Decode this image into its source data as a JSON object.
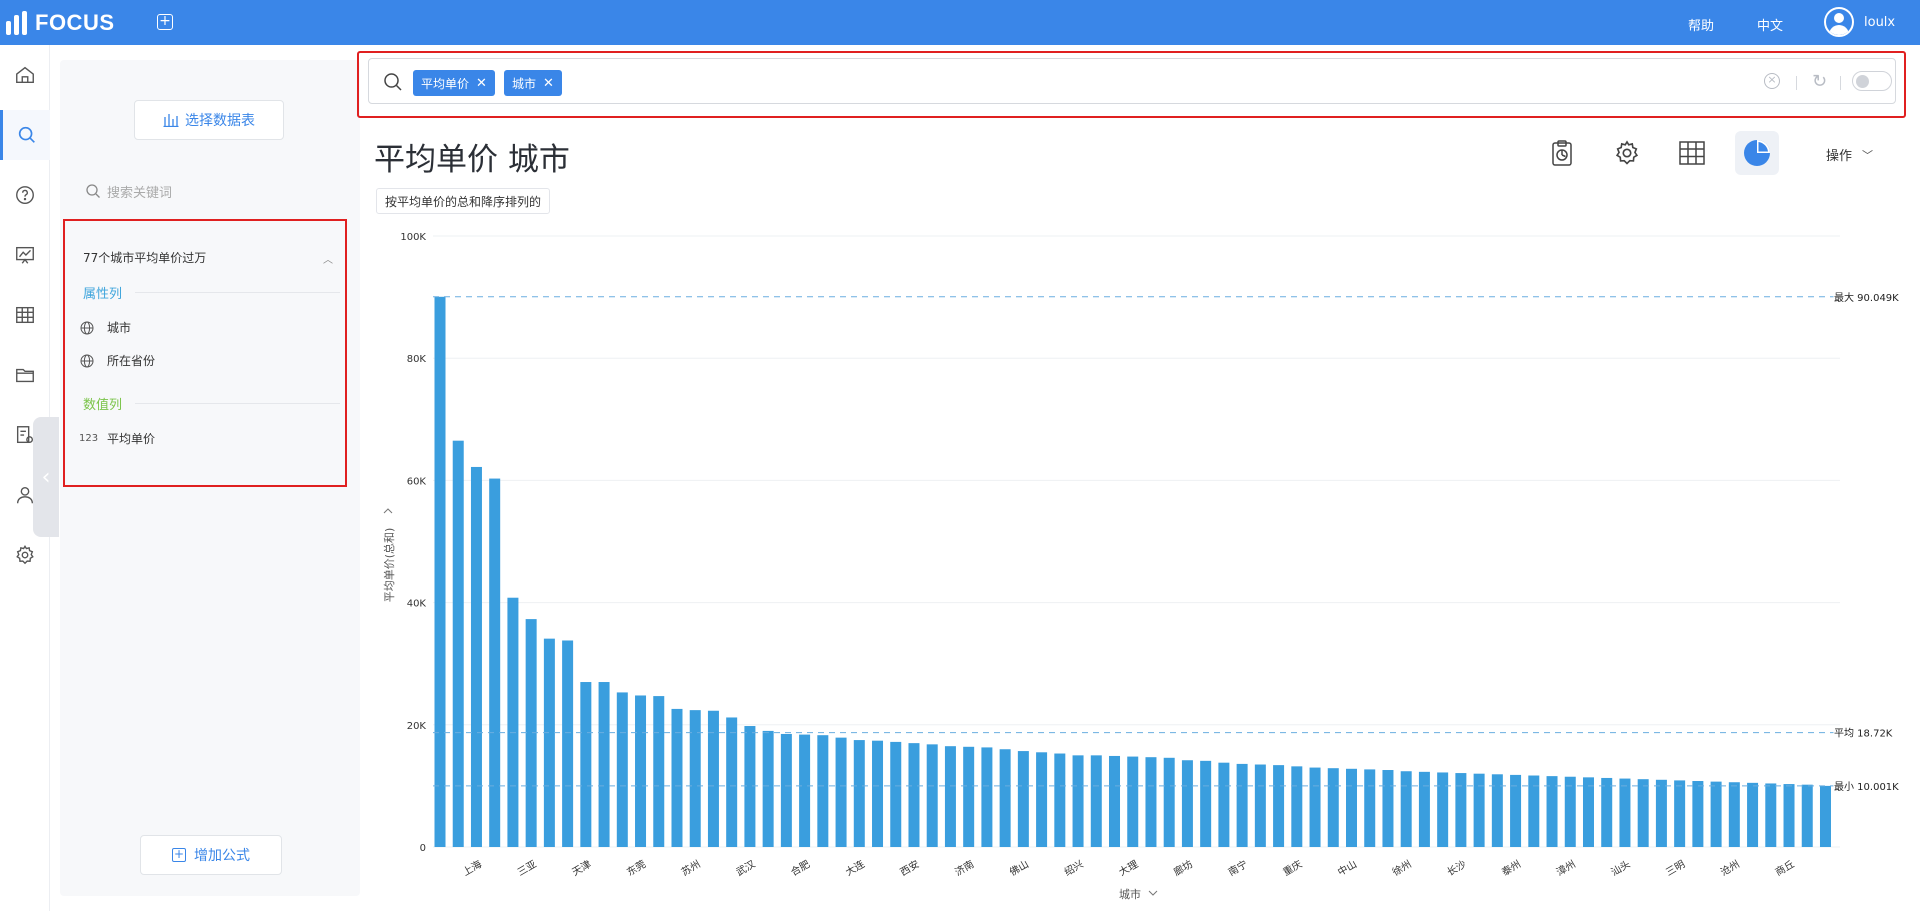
{
  "app": {
    "logo_text": "FOCUS",
    "help": "帮助",
    "language": "中文",
    "username": "loulx"
  },
  "nav": {
    "icons": [
      "home-icon",
      "search-icon",
      "help-icon",
      "dashboard-icon",
      "table-icon",
      "folder-icon",
      "report-settings-icon",
      "user-icon",
      "settings-icon"
    ],
    "active_index": 1
  },
  "side_panel": {
    "select_table_label": "选择数据表",
    "search_placeholder": "搜索关键词",
    "datasource_title": "77个城市平均单价过万",
    "attr_section": "属性列",
    "attr_items": [
      "城市",
      "所在省份"
    ],
    "num_section": "数值列",
    "num_items": [
      {
        "type": "123",
        "label": "平均单价"
      }
    ],
    "add_formula_label": "增加公式"
  },
  "search": {
    "chips": [
      "平均单价",
      "城市"
    ]
  },
  "result": {
    "title": "平均单价 城市",
    "sort_description": "按平均单价的总和降序排列的",
    "ops_label": "操作"
  },
  "colors": {
    "accent": "#3a86e8",
    "bar": "#3a9ede",
    "highlight_border": "#e02020",
    "reference_line": "#6aaee0"
  },
  "chart_data": {
    "type": "bar",
    "xlabel": "城市",
    "ylabel": "平均单价(总和)",
    "ylim": [
      0,
      100000
    ],
    "yticks": [
      {
        "value": 0,
        "label": "0"
      },
      {
        "value": 20000,
        "label": "20K"
      },
      {
        "value": 40000,
        "label": "40K"
      },
      {
        "value": 60000,
        "label": "60K"
      },
      {
        "value": 80000,
        "label": "80K"
      },
      {
        "value": 100000,
        "label": "100K"
      }
    ],
    "labeled_categories": [
      {
        "index": 2,
        "label": "上海"
      },
      {
        "index": 5,
        "label": "三亚"
      },
      {
        "index": 8,
        "label": "天津"
      },
      {
        "index": 11,
        "label": "东莞"
      },
      {
        "index": 14,
        "label": "苏州"
      },
      {
        "index": 17,
        "label": "武汉"
      },
      {
        "index": 20,
        "label": "合肥"
      },
      {
        "index": 23,
        "label": "大连"
      },
      {
        "index": 26,
        "label": "西安"
      },
      {
        "index": 29,
        "label": "济南"
      },
      {
        "index": 32,
        "label": "佛山"
      },
      {
        "index": 35,
        "label": "绍兴"
      },
      {
        "index": 38,
        "label": "大理"
      },
      {
        "index": 41,
        "label": "廊坊"
      },
      {
        "index": 44,
        "label": "南宁"
      },
      {
        "index": 47,
        "label": "重庆"
      },
      {
        "index": 50,
        "label": "中山"
      },
      {
        "index": 53,
        "label": "徐州"
      },
      {
        "index": 56,
        "label": "长沙"
      },
      {
        "index": 59,
        "label": "泰州"
      },
      {
        "index": 62,
        "label": "漳州"
      },
      {
        "index": 65,
        "label": "汕头"
      },
      {
        "index": 68,
        "label": "三明"
      },
      {
        "index": 71,
        "label": "沧州"
      },
      {
        "index": 74,
        "label": "商丘"
      }
    ],
    "values": [
      90049,
      66500,
      62200,
      60300,
      40800,
      37300,
      34100,
      33800,
      27000,
      27000,
      25300,
      24800,
      24700,
      22600,
      22400,
      22300,
      21200,
      19800,
      19000,
      18500,
      18400,
      18300,
      17900,
      17500,
      17400,
      17200,
      17000,
      16800,
      16500,
      16400,
      16300,
      16000,
      15700,
      15500,
      15300,
      15000,
      15000,
      14900,
      14800,
      14700,
      14600,
      14200,
      14100,
      13800,
      13600,
      13500,
      13400,
      13200,
      13000,
      12900,
      12800,
      12700,
      12600,
      12400,
      12300,
      12200,
      12100,
      12000,
      11900,
      11800,
      11700,
      11600,
      11500,
      11400,
      11300,
      11200,
      11100,
      11000,
      10900,
      10800,
      10700,
      10600,
      10500,
      10400,
      10300,
      10200,
      10001
    ],
    "reference_lines": [
      {
        "label": "最大 90.049K",
        "value": 90049
      },
      {
        "label": "平均 18.72K",
        "value": 18720
      },
      {
        "label": "最小 10.001K",
        "value": 10001
      }
    ]
  }
}
